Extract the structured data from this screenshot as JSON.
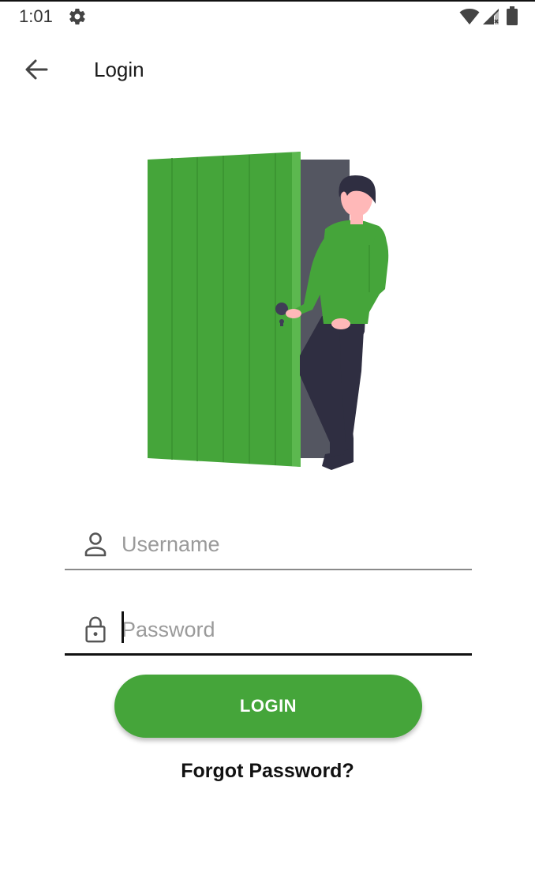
{
  "status_bar": {
    "time": "1:01",
    "settings_icon": "gear-icon",
    "wifi_icon": "wifi-icon",
    "signal_icon": "cellular-signal-icon",
    "battery_icon": "battery-icon"
  },
  "app_bar": {
    "back_icon": "arrow-left-icon",
    "title": "Login"
  },
  "illustration": {
    "name": "person-opening-door-illustration",
    "door_color": "#45a53a"
  },
  "form": {
    "username": {
      "icon": "person-icon",
      "placeholder": "Username",
      "value": ""
    },
    "password": {
      "icon": "lock-icon",
      "placeholder": "Password",
      "value": ""
    },
    "login_button_label": "LOGIN",
    "forgot_password_label": "Forgot Password?"
  },
  "colors": {
    "accent": "#45a53a",
    "text_primary": "#111111",
    "placeholder": "#9a9a9a"
  }
}
